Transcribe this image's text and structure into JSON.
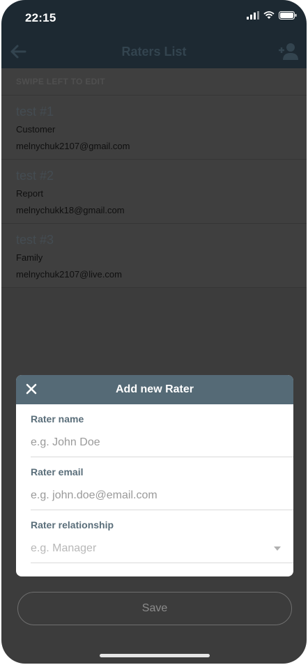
{
  "status_bar": {
    "time": "22:15"
  },
  "nav": {
    "title": "Raters List"
  },
  "list": {
    "hint": "SWIPE LEFT TO EDIT",
    "items": [
      {
        "name": "test #1",
        "relationship": "Customer",
        "email": "melnychuk2107@gmail.com"
      },
      {
        "name": "test #2",
        "relationship": "Report",
        "email": "melnychukk18@gmail.com"
      },
      {
        "name": "test #3",
        "relationship": "Family",
        "email": "melnychuk2107@live.com"
      }
    ]
  },
  "modal": {
    "title": "Add new Rater",
    "fields": [
      {
        "label": "Rater name",
        "placeholder": "e.g. John Doe",
        "value": ""
      },
      {
        "label": "Rater email",
        "placeholder": "e.g. john.doe@email.com",
        "value": ""
      },
      {
        "label": "Rater relationship",
        "placeholder": "e.g. Manager",
        "value": ""
      }
    ]
  },
  "save_button": {
    "label": "Save"
  },
  "colors": {
    "header_bg": "#1d2932",
    "overlay_bg": "#3c3c3c",
    "modal_header": "#556a76",
    "label": "#5a6e7a"
  },
  "icons": [
    "signal-icon",
    "wifi-icon",
    "battery-icon",
    "back-arrow-icon",
    "add-user-icon",
    "close-icon",
    "chevron-down-icon"
  ]
}
